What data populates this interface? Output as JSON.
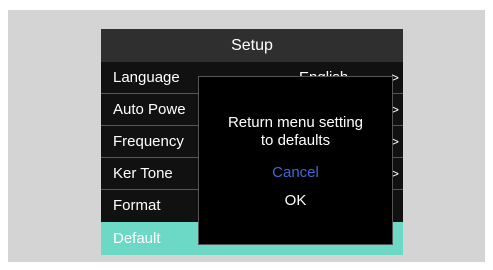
{
  "menu": {
    "title": "Setup",
    "items": [
      {
        "label": "Language",
        "value": "English",
        "chevron": ">"
      },
      {
        "label": "Auto Powe",
        "chevron": ">"
      },
      {
        "label": "Frequency",
        "chevron": ">"
      },
      {
        "label": "Ker Tone",
        "chevron": ">"
      },
      {
        "label": "Format",
        "chevron": ""
      },
      {
        "label": "Default",
        "chevron": ""
      }
    ],
    "selected_index": 5
  },
  "dialog": {
    "message_line1": "Return menu setting",
    "message_line2": "to defaults",
    "cancel_label": "Cancel",
    "ok_label": "OK"
  },
  "colors": {
    "selected_row": "#6bd9c5",
    "cancel_text": "#3d6bd1",
    "title_bar": "#2f2f2f"
  }
}
